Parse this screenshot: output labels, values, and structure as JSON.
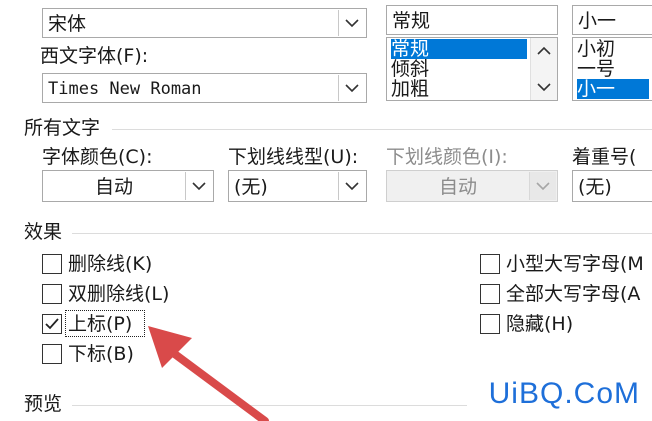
{
  "top_row": {
    "chinese_font_value": "宋体",
    "style_value": "常规",
    "size_value": "小一"
  },
  "western_font": {
    "label": "西文字体(F):",
    "value": "Times New Roman"
  },
  "style_list": {
    "items": [
      "常规",
      "倾斜",
      "加粗"
    ],
    "selected_index": 0
  },
  "size_list": {
    "items": [
      "小初",
      "一号",
      "小一"
    ],
    "selected_index": 2
  },
  "all_text": {
    "section_label": "所有文字",
    "font_color": {
      "label": "字体颜色(C):",
      "value": "自动"
    },
    "underline_type": {
      "label": "下划线线型(U):",
      "value": "(无)"
    },
    "underline_color": {
      "label": "下划线颜色(I):",
      "value": "自动"
    },
    "emphasis_mark": {
      "label": "着重号(",
      "value": "(无)"
    }
  },
  "effects": {
    "section_label": "效果",
    "left": [
      {
        "label": "删除线(K)",
        "checked": false
      },
      {
        "label": "双删除线(L)",
        "checked": false
      },
      {
        "label": "上标(P)",
        "checked": true
      },
      {
        "label": "下标(B)",
        "checked": false
      }
    ],
    "right": [
      {
        "label": "小型大写字母(M",
        "checked": false
      },
      {
        "label": "全部大写字母(A",
        "checked": false
      },
      {
        "label": "隐藏(H)",
        "checked": false
      }
    ]
  },
  "preview": {
    "section_label": "预览"
  },
  "watermark": "UiBQ.CoM",
  "colors": {
    "selection": "#0078d7",
    "annotation_arrow": "#d94a4a",
    "watermark": "#1e6fd9"
  },
  "icons": {
    "dropdown": "chevron-down-icon",
    "check": "check-icon",
    "scroll_up": "scroll-up-icon",
    "scroll_down": "scroll-down-icon"
  }
}
